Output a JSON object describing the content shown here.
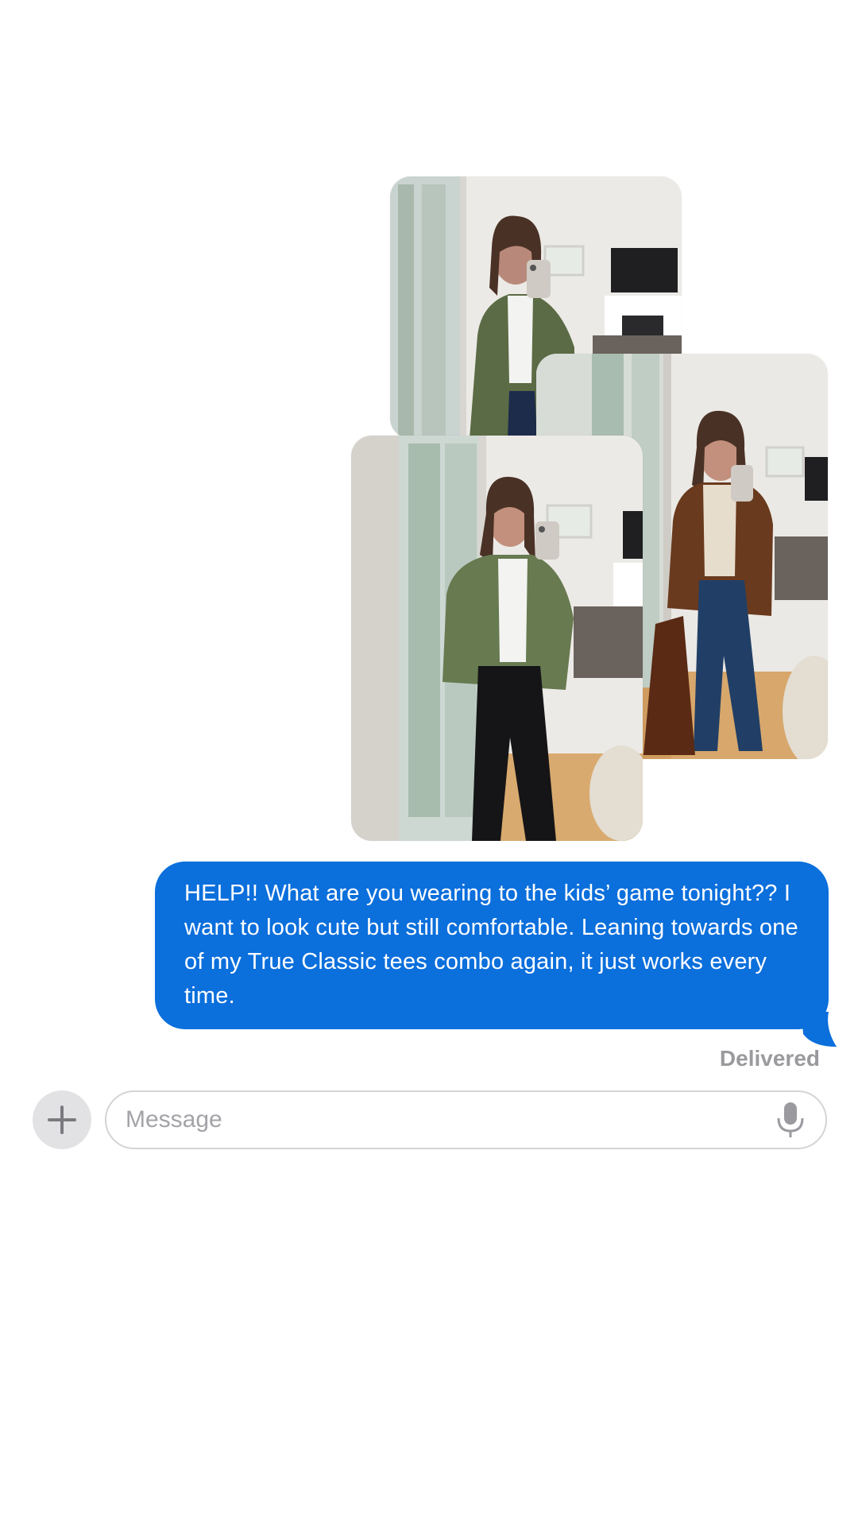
{
  "photos": [
    {
      "subject": "woman in olive blazer and white tee taking mirror selfie"
    },
    {
      "subject": "woman in brown cardigan, cream tee and jeans holding tote"
    },
    {
      "subject": "woman in green utility jacket, white tee and black pants"
    }
  ],
  "message": {
    "text": "HELP!! What are you wearing to the kids’ game tonight?? I want to look cute but still comfortable. Leaning towards one of my True Classic tees combo again, it just works every time.",
    "status": "Delivered",
    "bubble_color": "#0b6fdc"
  },
  "composer": {
    "placeholder": "Message",
    "value": "",
    "plus_icon": "plus-icon",
    "mic_icon": "microphone-icon"
  }
}
